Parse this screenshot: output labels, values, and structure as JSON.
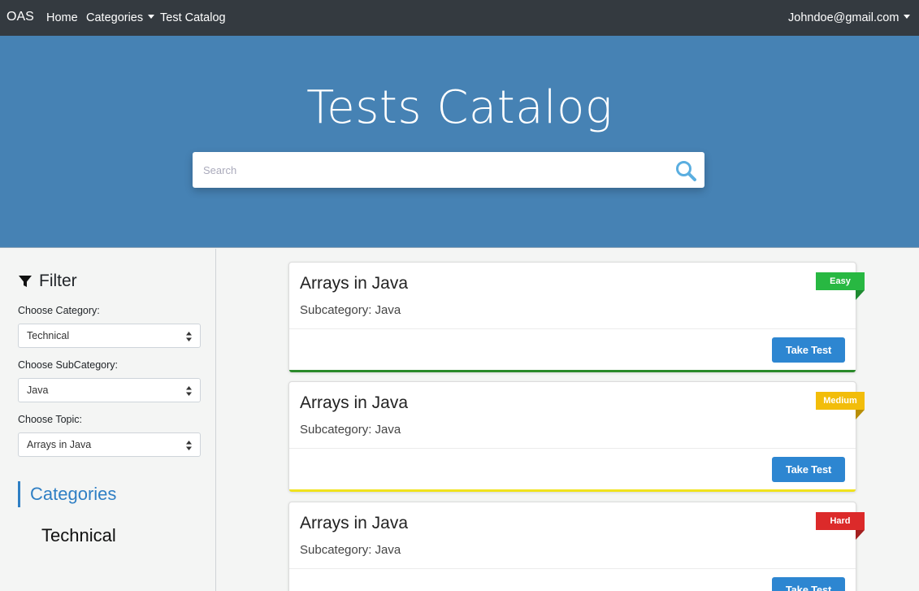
{
  "nav": {
    "brand": "OAS",
    "home": "Home",
    "categories": "Categories",
    "test_catalog": "Test Catalog",
    "user": "Johndoe@gmail.com"
  },
  "hero": {
    "title": "Tests Catalog",
    "search_placeholder": "Search"
  },
  "filter": {
    "heading": "Filter",
    "category_label": "Choose Category:",
    "category_value": "Technical",
    "subcategory_label": "Choose SubCategory:",
    "subcategory_value": "Java",
    "topic_label": "Choose Topic:",
    "topic_value": "Arrays in Java"
  },
  "categories": {
    "heading": "Categories",
    "items": [
      "Technical"
    ]
  },
  "cards": [
    {
      "title": "Arrays in Java",
      "subcategory": "Subcategory: Java",
      "difficulty": "Easy",
      "color": "#28b842",
      "fold": "#1e8a31",
      "bottom": "#2a8a2a",
      "button": "Take Test"
    },
    {
      "title": "Arrays in Java",
      "subcategory": "Subcategory: Java",
      "difficulty": "Medium",
      "color": "#f2bd0a",
      "fold": "#b88e06",
      "bottom": "#f0e21c",
      "button": "Take Test"
    },
    {
      "title": "Arrays in Java",
      "subcategory": "Subcategory: Java",
      "difficulty": "Hard",
      "color": "#dc2a2a",
      "fold": "#a31f1f",
      "bottom": "#dc2a2a",
      "button": "Take Test"
    }
  ],
  "colors": {
    "navbar": "#343a40",
    "hero": "#4682b4",
    "accent": "#2d86d1"
  }
}
